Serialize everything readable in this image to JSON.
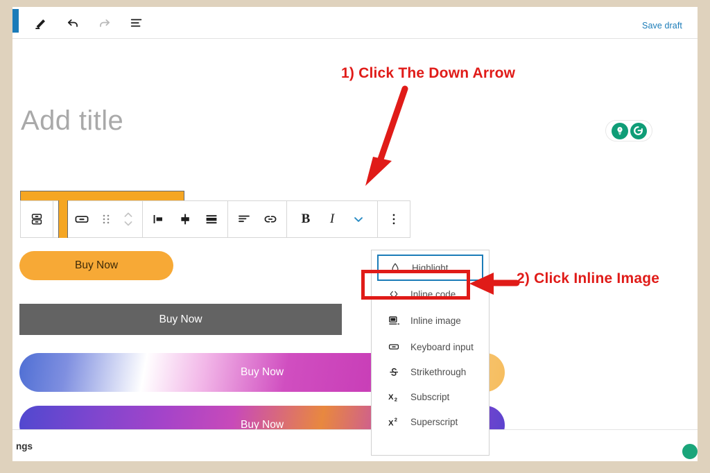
{
  "window": {
    "background_color": "#dfd2bd",
    "canvas_color": "#ffffff"
  },
  "topbar": {
    "icons": [
      {
        "name": "pen-icon",
        "label": "Edit"
      },
      {
        "name": "undo-icon",
        "label": "Undo"
      },
      {
        "name": "redo-icon",
        "label": "Redo"
      },
      {
        "name": "list-view-icon",
        "label": "Document overview"
      }
    ],
    "save_draft_label": "Save draft",
    "save_draft_color": "#1b7cb8"
  },
  "editor": {
    "title_placeholder": "Add title",
    "status_pill": {
      "icons": [
        "lightbulb-icon",
        "refresh-icon"
      ],
      "color": "#0f9d77"
    }
  },
  "block_toolbar": {
    "selected_indicator_color": "#f5a623",
    "groups": [
      {
        "name": "block-type",
        "items": [
          {
            "name": "block-type-icon",
            "label": "Buttons"
          }
        ]
      },
      {
        "name": "block-controls",
        "items": [
          {
            "name": "button-block-icon",
            "label": "Button"
          },
          {
            "name": "drag-handle-icon",
            "label": "Drag"
          },
          {
            "name": "move-updown-icon",
            "label": "Move up or down"
          }
        ]
      },
      {
        "name": "alignment",
        "items": [
          {
            "name": "align-left-icon",
            "label": "Align left"
          },
          {
            "name": "align-center-icon",
            "label": "Align center"
          },
          {
            "name": "align-full-icon",
            "label": "Full width"
          }
        ]
      },
      {
        "name": "text-controls",
        "items": [
          {
            "name": "text-align-icon",
            "label": "Change text alignment"
          },
          {
            "name": "link-icon",
            "label": "Link"
          }
        ]
      },
      {
        "name": "formatting",
        "items": [
          {
            "name": "bold-icon",
            "label": "B"
          },
          {
            "name": "italic-icon",
            "label": "I"
          },
          {
            "name": "chevron-down-icon",
            "label": "More rich text controls"
          }
        ]
      },
      {
        "name": "more-options",
        "items": [
          {
            "name": "ellipsis-vertical-icon",
            "label": "Options"
          }
        ]
      }
    ],
    "chevron_color": "#1b7cb8"
  },
  "content_blocks": [
    {
      "name": "buy-now-orange",
      "label": "Buy Now",
      "style": "rounded-orange"
    },
    {
      "name": "buy-now-grey",
      "label": "Buy Now",
      "style": "rectangle-grey"
    },
    {
      "name": "buy-now-gradient-1",
      "label": "Buy Now",
      "style": "gradient-blue-magenta-orange"
    },
    {
      "name": "buy-now-gradient-2",
      "label": "Buy Now",
      "style": "gradient-purple-orange"
    }
  ],
  "dropdown": {
    "items": [
      {
        "name": "highlight",
        "icon": "highlight-drop-icon",
        "label": "Highlight",
        "focused": true
      },
      {
        "name": "inline-code",
        "icon": "code-angle-brackets-icon",
        "label": "Inline code",
        "focused": false
      },
      {
        "name": "inline-image",
        "icon": "inline-image-icon",
        "label": "Inline image",
        "focused": false
      },
      {
        "name": "keyboard-input",
        "icon": "keyboard-input-icon",
        "label": "Keyboard input",
        "focused": false
      },
      {
        "name": "strikethrough",
        "icon": "strikethrough-icon",
        "label": "Strikethrough",
        "focused": false
      },
      {
        "name": "subscript",
        "icon": "subscript-icon",
        "label": "Subscript",
        "focused": false
      },
      {
        "name": "superscript",
        "icon": "superscript-icon",
        "label": "Superscript",
        "focused": false
      }
    ],
    "focus_outline_color": "#1b7cb8"
  },
  "annotations": {
    "color": "#e01b18",
    "step1": "1) Click The Down Arrow",
    "step2": "2) Click Inline Image"
  },
  "footer": {
    "breadcrumb_text": "ngs"
  }
}
